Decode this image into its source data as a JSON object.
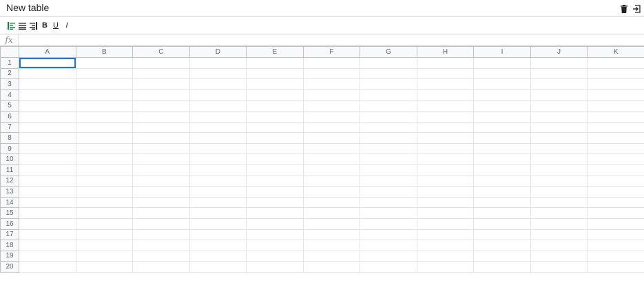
{
  "header": {
    "title": "New table"
  },
  "toolbar": {
    "bold_label": "B",
    "underline_label": "U",
    "italic_label": "I"
  },
  "formula": {
    "fx_label": "fx",
    "value": ""
  },
  "grid": {
    "columns": [
      "A",
      "B",
      "C",
      "D",
      "E",
      "F",
      "G",
      "H",
      "I",
      "J",
      "K"
    ],
    "rows": [
      "1",
      "2",
      "3",
      "4",
      "5",
      "6",
      "7",
      "8",
      "9",
      "10",
      "11",
      "12",
      "13",
      "14",
      "15",
      "16",
      "17",
      "18",
      "19",
      "20"
    ],
    "selected_cell": "A1"
  },
  "colors": {
    "accent": "#1a73e8",
    "align_left_active": "#188038"
  }
}
